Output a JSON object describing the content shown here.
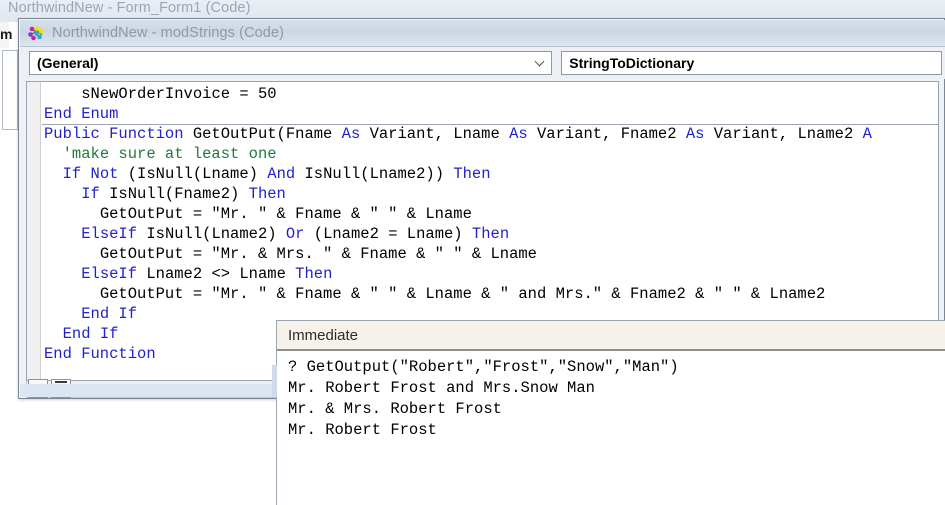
{
  "background_window": {
    "title": "NorthwindNew - Form_Form1 (Code)",
    "left_marker": "m"
  },
  "code_window": {
    "icon": "vba-module-icon",
    "title": "NorthwindNew - modStrings (Code)",
    "object_combo": {
      "value": "(General)",
      "chevron": "chevron-down-icon"
    },
    "procedure_combo": {
      "value": "StringToDictionary"
    },
    "lines": [
      {
        "indent": 4,
        "segments": [
          {
            "t": "sNewOrderInvoice = 50",
            "c": "pl"
          }
        ]
      },
      {
        "indent": 0,
        "segments": [
          {
            "t": "End Enum",
            "c": "kw"
          }
        ]
      },
      {
        "indent": 0,
        "segments": [
          {
            "t": "Public Function ",
            "c": "kw"
          },
          {
            "t": "GetOutPut(Fname ",
            "c": "pl"
          },
          {
            "t": "As ",
            "c": "kw"
          },
          {
            "t": "Variant, Lname ",
            "c": "pl"
          },
          {
            "t": "As ",
            "c": "kw"
          },
          {
            "t": "Variant, Fname2 ",
            "c": "pl"
          },
          {
            "t": "As ",
            "c": "kw"
          },
          {
            "t": "Variant, Lname2 ",
            "c": "pl"
          },
          {
            "t": "A",
            "c": "kw"
          }
        ]
      },
      {
        "indent": 2,
        "segments": [
          {
            "t": "'make sure at least one",
            "c": "cm"
          }
        ]
      },
      {
        "indent": 2,
        "segments": [
          {
            "t": "If Not ",
            "c": "kw"
          },
          {
            "t": "(IsNull(Lname) ",
            "c": "pl"
          },
          {
            "t": "And ",
            "c": "kw"
          },
          {
            "t": "IsNull(Lname2)) ",
            "c": "pl"
          },
          {
            "t": "Then",
            "c": "kw"
          }
        ]
      },
      {
        "indent": 4,
        "segments": [
          {
            "t": "If ",
            "c": "kw"
          },
          {
            "t": "IsNull(Fname2) ",
            "c": "pl"
          },
          {
            "t": "Then",
            "c": "kw"
          }
        ]
      },
      {
        "indent": 6,
        "segments": [
          {
            "t": "GetOutPut = \"Mr. \" & Fname & \" \" & Lname",
            "c": "pl"
          }
        ]
      },
      {
        "indent": 4,
        "segments": [
          {
            "t": "ElseIf ",
            "c": "kw"
          },
          {
            "t": "IsNull(Lname2) ",
            "c": "pl"
          },
          {
            "t": "Or ",
            "c": "kw"
          },
          {
            "t": "(Lname2 = Lname) ",
            "c": "pl"
          },
          {
            "t": "Then",
            "c": "kw"
          }
        ]
      },
      {
        "indent": 6,
        "segments": [
          {
            "t": "GetOutPut = \"Mr. & Mrs. \" & Fname & \" \" & Lname",
            "c": "pl"
          }
        ]
      },
      {
        "indent": 4,
        "segments": [
          {
            "t": "ElseIf ",
            "c": "kw"
          },
          {
            "t": "Lname2 <> Lname ",
            "c": "pl"
          },
          {
            "t": "Then",
            "c": "kw"
          }
        ]
      },
      {
        "indent": 6,
        "segments": [
          {
            "t": "GetOutPut = \"Mr. \" & Fname & \" \" & Lname & \" and Mrs.\" & Fname2 & \" \" & Lname2",
            "c": "pl"
          }
        ]
      },
      {
        "indent": 4,
        "segments": [
          {
            "t": "End If",
            "c": "kw"
          }
        ]
      },
      {
        "indent": 2,
        "segments": [
          {
            "t": "End If",
            "c": "kw"
          }
        ]
      },
      {
        "indent": 0,
        "segments": [
          {
            "t": "End Function",
            "c": "kw"
          }
        ]
      }
    ],
    "view_buttons": {
      "procedure_view": "procedure-view-button",
      "full_module_view": "full-module-view-button"
    },
    "horizontal_scrollbar": "code-hscrollbar"
  },
  "immediate_window": {
    "title": "Immediate",
    "lines": [
      "? GetOutput(\"Robert\",\"Frost\",\"Snow\",\"Man\")",
      "Mr. Robert Frost and Mrs.Snow Man",
      "Mr. & Mrs. Robert Frost",
      "Mr. Robert Frost"
    ]
  },
  "colors": {
    "keyword": "#2222CC",
    "comment": "#1F7A3D",
    "titlebar_top": "#D6E0EA",
    "titlebar_bottom": "#DDE6EF",
    "immediate_header": "#F7F2E9",
    "inactive_title_text": "#8E99A6"
  }
}
